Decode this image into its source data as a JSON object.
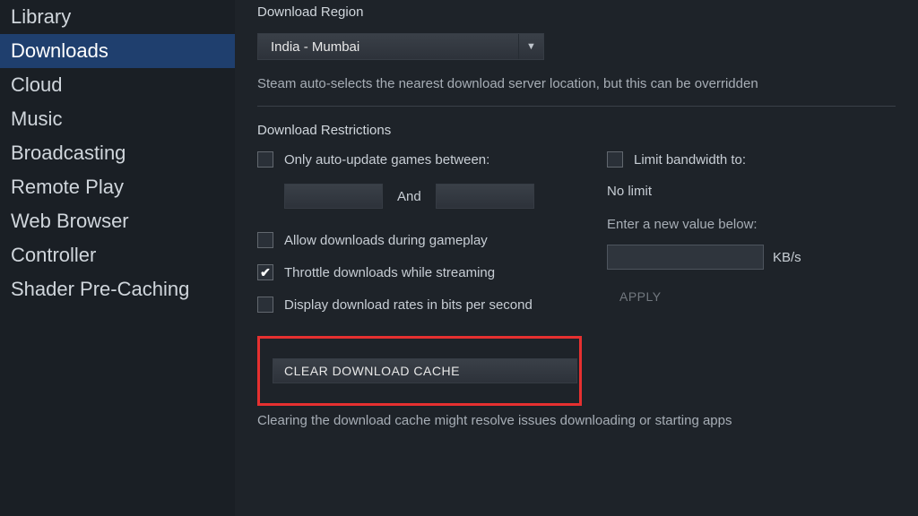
{
  "sidebar": {
    "items": [
      {
        "label": "Library"
      },
      {
        "label": "Downloads"
      },
      {
        "label": "Cloud"
      },
      {
        "label": "Music"
      },
      {
        "label": "Broadcasting"
      },
      {
        "label": "Remote Play"
      },
      {
        "label": "Web Browser"
      },
      {
        "label": "Controller"
      },
      {
        "label": "Shader Pre-Caching"
      }
    ]
  },
  "region": {
    "title": "Download Region",
    "selected": "India - Mumbai",
    "description": "Steam auto-selects the nearest download server location, but this can be overridden"
  },
  "restrictions": {
    "title": "Download Restrictions",
    "auto_update_label": "Only auto-update games between:",
    "and_label": "And",
    "allow_gameplay_label": "Allow downloads during gameplay",
    "throttle_label": "Throttle downloads while streaming",
    "bits_label": "Display download rates in bits per second",
    "limit_bw_label": "Limit bandwidth to:",
    "no_limit": "No limit",
    "enter_value": "Enter a new value below:",
    "kbs": "KB/s",
    "apply": "APPLY"
  },
  "cache": {
    "button": "CLEAR DOWNLOAD CACHE",
    "description": "Clearing the download cache might resolve issues downloading or starting apps"
  }
}
